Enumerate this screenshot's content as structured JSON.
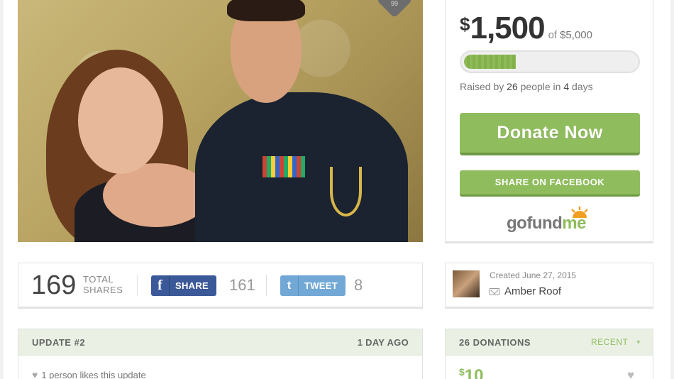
{
  "campaign": {
    "photo_badge": "99"
  },
  "funding": {
    "currency": "$",
    "raised": "1,500",
    "of_label": "of",
    "goal": "$5,000",
    "progress_fraction": 0.3,
    "raised_by_prefix": "Raised by",
    "donor_count": "26",
    "people_in": "people in",
    "day_count": "4",
    "days_label": "days",
    "donate_label": "Donate Now",
    "share_facebook_label": "SHARE ON FACEBOOK",
    "logo_go_fund": "gofund",
    "logo_me": "me"
  },
  "shares": {
    "total": "169",
    "total_label_1": "TOTAL",
    "total_label_2": "SHARES",
    "facebook_icon": "f",
    "facebook_label": "SHARE",
    "facebook_count": "161",
    "twitter_icon": "t",
    "twitter_label": "TWEET",
    "twitter_count": "8"
  },
  "creator": {
    "created": "Created June 27, 2015",
    "name": "Amber Roof"
  },
  "update": {
    "title": "UPDATE #2",
    "time": "1 DAY AGO",
    "likes": "1 person likes this update"
  },
  "donations": {
    "title": "26 DONATIONS",
    "sort": "RECENT",
    "first_amount_currency": "$",
    "first_amount": "10"
  },
  "colors": {
    "accent_green": "#8fbc5d",
    "facebook_blue": "#3b5998",
    "twitter_blue": "#72a8d6"
  }
}
